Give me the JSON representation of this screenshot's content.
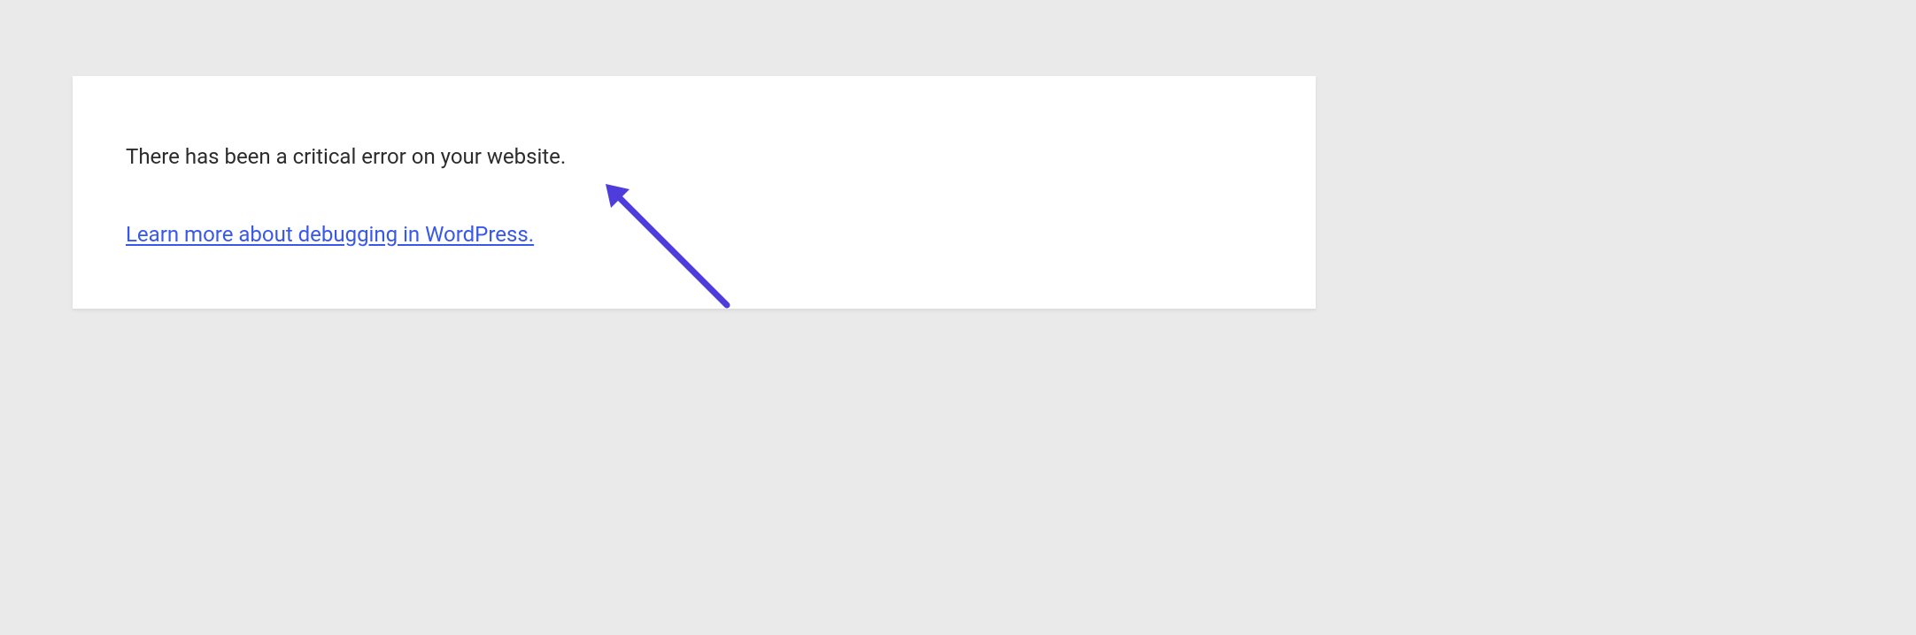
{
  "error": {
    "message": "There has been a critical error on your website.",
    "link_text": "Learn more about debugging in WordPress."
  }
}
